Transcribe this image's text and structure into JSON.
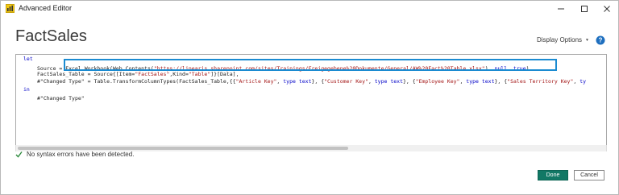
{
  "window": {
    "title": "Advanced Editor",
    "controls": {
      "minimize": "minimize",
      "maximize": "maximize",
      "close": "close"
    }
  },
  "header": {
    "title": "FactSales",
    "display_options_label": "Display Options",
    "help_label": "?"
  },
  "editor": {
    "lines": [
      {
        "indent": 0,
        "tokens": [
          {
            "t": "let",
            "c": "kw"
          }
        ]
      },
      {
        "indent": 1,
        "tokens": [
          {
            "t": "Source = ",
            "c": ""
          },
          {
            "t": "Excel.Workbook(Web.Contents(",
            "c": ""
          },
          {
            "t": "\"https://linearis.sharepoint.com/sites/Trainings/Freigegebene%20Dokumente/General/AW%20Fact%20Table.xlsx\"",
            "c": "str"
          },
          {
            "t": "), ",
            "c": ""
          },
          {
            "t": "null",
            "c": "kw"
          },
          {
            "t": ", ",
            "c": ""
          },
          {
            "t": "true",
            "c": "kw"
          },
          {
            "t": "),",
            "c": ""
          }
        ]
      },
      {
        "indent": 1,
        "tokens": [
          {
            "t": "FactSales_Table = Source{[Item=",
            "c": ""
          },
          {
            "t": "\"FactSales\"",
            "c": "str"
          },
          {
            "t": ",Kind=",
            "c": ""
          },
          {
            "t": "\"Table\"",
            "c": "str"
          },
          {
            "t": "]}[Data],",
            "c": ""
          }
        ]
      },
      {
        "indent": 1,
        "tokens": [
          {
            "t": "#\"Changed Type\" = Table.TransformColumnTypes(FactSales_Table,{{",
            "c": ""
          },
          {
            "t": "\"Article Key\"",
            "c": "str"
          },
          {
            "t": ", ",
            "c": ""
          },
          {
            "t": "type text",
            "c": "kw"
          },
          {
            "t": "}, {",
            "c": ""
          },
          {
            "t": "\"Customer Key\"",
            "c": "str"
          },
          {
            "t": ", ",
            "c": ""
          },
          {
            "t": "type text",
            "c": "kw"
          },
          {
            "t": "}, {",
            "c": ""
          },
          {
            "t": "\"Employee Key\"",
            "c": "str"
          },
          {
            "t": ", ",
            "c": ""
          },
          {
            "t": "type text",
            "c": "kw"
          },
          {
            "t": "}, {",
            "c": ""
          },
          {
            "t": "\"Sales Territory Key\"",
            "c": "str"
          },
          {
            "t": ", ",
            "c": ""
          },
          {
            "t": "ty",
            "c": "kw"
          }
        ]
      },
      {
        "indent": 0,
        "tokens": [
          {
            "t": "in",
            "c": "kw"
          }
        ]
      },
      {
        "indent": 1,
        "tokens": [
          {
            "t": "#\"Changed Type\"",
            "c": ""
          }
        ]
      }
    ]
  },
  "status": {
    "message": "No syntax errors have been detected."
  },
  "footer": {
    "done_label": "Done",
    "cancel_label": "Cancel"
  },
  "colors": {
    "done_button": "#117865",
    "highlight": "#1b8bd1",
    "keyword": "#0000c8",
    "string": "#a31515",
    "check": "#2e8b3e",
    "help": "#1e6fbf"
  },
  "icons": {
    "app": "advanced-editor-app-icon",
    "help": "help-icon",
    "status": "check-icon",
    "dropdown": "caret-down-icon"
  }
}
